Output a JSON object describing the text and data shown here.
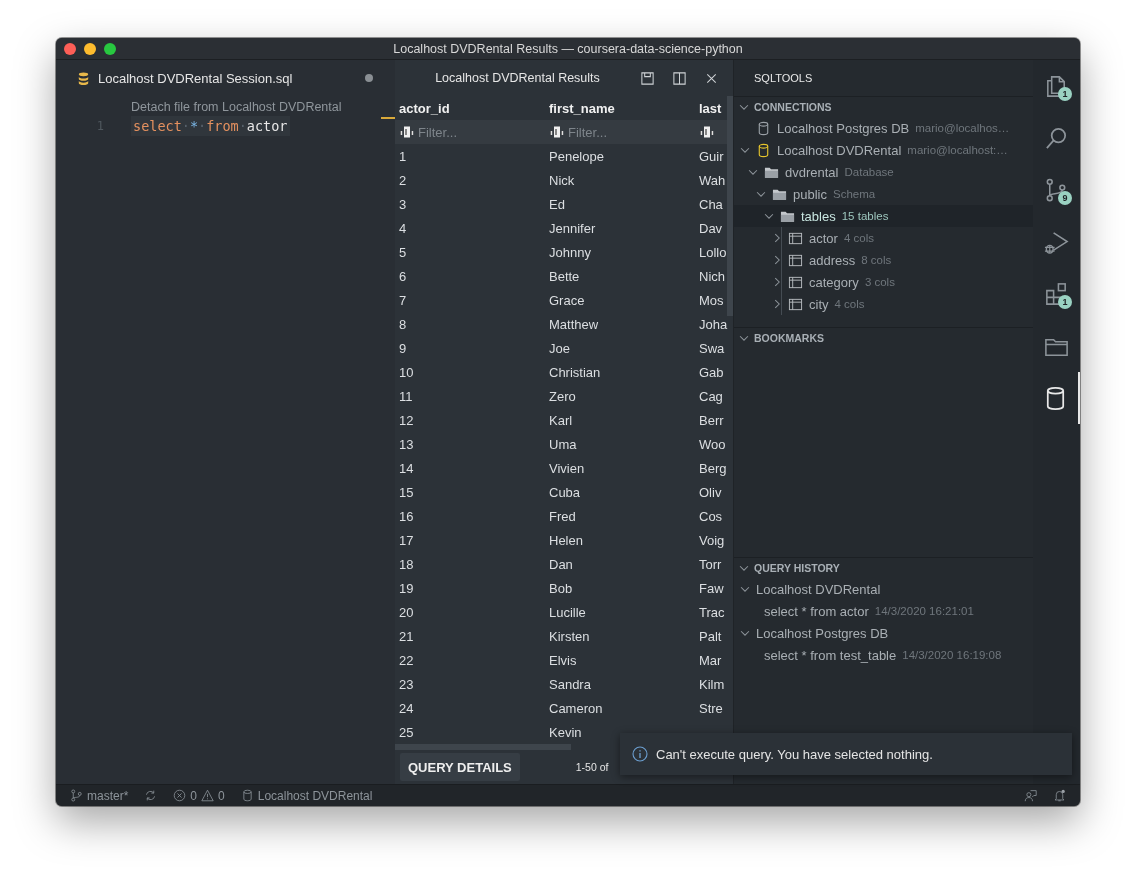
{
  "window": {
    "title": "Localhost DVDRental Results — coursera-data-science-python"
  },
  "editor": {
    "tab": {
      "label": "Localhost DVDRental Session.sql",
      "modified": true
    },
    "codelens": "Detach file from Localhost DVDRental",
    "lines": [
      {
        "number": "1",
        "tokens": [
          {
            "kind": "keyword",
            "text": "select"
          },
          {
            "kind": "space",
            "text": "·"
          },
          {
            "kind": "operator",
            "text": "*"
          },
          {
            "kind": "space",
            "text": "·"
          },
          {
            "kind": "keyword",
            "text": "from"
          },
          {
            "kind": "space",
            "text": "·"
          },
          {
            "kind": "identifier",
            "text": "actor"
          }
        ]
      }
    ]
  },
  "results": {
    "title": "Localhost DVDRental Results",
    "columns": [
      {
        "label": "actor_id",
        "placeholder": "Filter..."
      },
      {
        "label": "first_name",
        "placeholder": "Filter..."
      },
      {
        "label": "last"
      }
    ],
    "rows": [
      [
        "1",
        "Penelope",
        "Guir"
      ],
      [
        "2",
        "Nick",
        "Wah"
      ],
      [
        "3",
        "Ed",
        "Cha"
      ],
      [
        "4",
        "Jennifer",
        "Dav"
      ],
      [
        "5",
        "Johnny",
        "Lollo"
      ],
      [
        "6",
        "Bette",
        "Nich"
      ],
      [
        "7",
        "Grace",
        "Mos"
      ],
      [
        "8",
        "Matthew",
        "Joha"
      ],
      [
        "9",
        "Joe",
        "Swa"
      ],
      [
        "10",
        "Christian",
        "Gab"
      ],
      [
        "11",
        "Zero",
        "Cag"
      ],
      [
        "12",
        "Karl",
        "Berr"
      ],
      [
        "13",
        "Uma",
        "Woo"
      ],
      [
        "14",
        "Vivien",
        "Berg"
      ],
      [
        "15",
        "Cuba",
        "Oliv"
      ],
      [
        "16",
        "Fred",
        "Cos"
      ],
      [
        "17",
        "Helen",
        "Voig"
      ],
      [
        "18",
        "Dan",
        "Torr"
      ],
      [
        "19",
        "Bob",
        "Faw"
      ],
      [
        "20",
        "Lucille",
        "Trac"
      ],
      [
        "21",
        "Kirsten",
        "Palt"
      ],
      [
        "22",
        "Elvis",
        "Mar"
      ],
      [
        "23",
        "Sandra",
        "Kilm"
      ],
      [
        "24",
        "Cameron",
        "Stre"
      ],
      [
        "25",
        "Kevin"
      ]
    ],
    "query_details_button": "QUERY DETAILS",
    "page_info": "1-50 of"
  },
  "sidebar": {
    "title": "SQLTOOLS",
    "sections": [
      {
        "title": "CONNECTIONS",
        "expanded": true,
        "items": [
          {
            "label": "Localhost Postgres DB",
            "detail": "mario@localhos…",
            "kind": "connection",
            "connected": false,
            "selected": false
          },
          {
            "label": "Localhost DVDRental",
            "detail": "mario@localhost:…",
            "kind": "connection",
            "connected": true,
            "expanded": true,
            "selected": false,
            "children": [
              {
                "label": "dvdrental",
                "detail": "Database",
                "kind": "folder",
                "expanded": true,
                "selected": false,
                "children": [
                  {
                    "label": "public",
                    "detail": "Schema",
                    "kind": "folder",
                    "expanded": true,
                    "selected": false,
                    "children": [
                      {
                        "label": "tables",
                        "detail": "15 tables",
                        "kind": "folder",
                        "expanded": true,
                        "selected": true,
                        "children": [
                          {
                            "label": "actor",
                            "detail": "4 cols",
                            "kind": "table",
                            "expanded": false,
                            "selected": false
                          },
                          {
                            "label": "address",
                            "detail": "8 cols",
                            "kind": "table",
                            "expanded": false,
                            "selected": false
                          },
                          {
                            "label": "category",
                            "detail": "3 cols",
                            "kind": "table",
                            "expanded": false,
                            "selected": false
                          },
                          {
                            "label": "city",
                            "detail": "4 cols",
                            "kind": "table",
                            "expanded": false,
                            "selected": false
                          }
                        ]
                      }
                    ]
                  }
                ]
              }
            ]
          }
        ]
      },
      {
        "title": "BOOKMARKS",
        "expanded": true
      },
      {
        "title": "QUERY HISTORY",
        "expanded": true,
        "items": [
          {
            "label": "Localhost DVDRental",
            "kind": "group",
            "expanded": true,
            "selected": false,
            "children": [
              {
                "label": "select * from actor",
                "detail": "14/3/2020 16:21:01",
                "kind": "query",
                "selected": false
              }
            ]
          },
          {
            "label": "Localhost Postgres DB",
            "kind": "group",
            "expanded": true,
            "selected": false,
            "children": [
              {
                "label": "select * from test_table",
                "detail": "14/3/2020 16:19:08",
                "kind": "query",
                "selected": false
              }
            ]
          }
        ]
      }
    ]
  },
  "activity_bar": [
    {
      "kind": "files",
      "badge": "1",
      "selected": false
    },
    {
      "kind": "search",
      "selected": false
    },
    {
      "kind": "source-control",
      "badge": "9",
      "selected": false
    },
    {
      "kind": "run",
      "selected": false
    },
    {
      "kind": "extensions",
      "badge": "1",
      "selected": false
    },
    {
      "kind": "folder",
      "selected": false
    },
    {
      "kind": "database",
      "selected": true
    }
  ],
  "status_bar": {
    "branch": "master*",
    "errors": "0",
    "warnings": "0",
    "connection": "Localhost DVDRental"
  },
  "notification": {
    "message": "Can't execute query. You have selected nothing."
  }
}
